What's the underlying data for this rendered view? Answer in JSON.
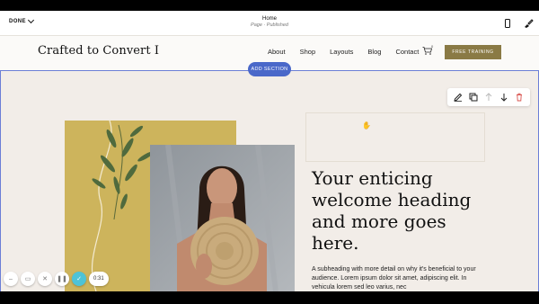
{
  "editor": {
    "done_label": "DONE",
    "page_title": "Home",
    "page_status": "Page · Published"
  },
  "site": {
    "logo": "Crafted to Convert I",
    "nav": [
      "About",
      "Shop",
      "Layouts",
      "Blog",
      "Contact"
    ],
    "cart_count": "0",
    "cta_label": "FREE TRAINING",
    "cta_color": "#8a7a45"
  },
  "section": {
    "add_section_label": "ADD SECTION",
    "heading": "Your enticing welcome heading and more goes here.",
    "subheading": "A subheading with more detail on why it's beneficial to your audience. Lorem ipsum dolor sit amet, adipiscing elit. In vehicula lorem sed leo varius, nec"
  },
  "toolbar": {
    "icons": [
      "edit-icon",
      "duplicate-icon",
      "move-up-icon",
      "move-down-icon",
      "delete-icon"
    ]
  },
  "recorder": {
    "timer": "0:31"
  },
  "colors": {
    "accent_blue": "#4a68c9",
    "selection_border": "#6b7fd6",
    "confirm": "#4ec3d6"
  }
}
